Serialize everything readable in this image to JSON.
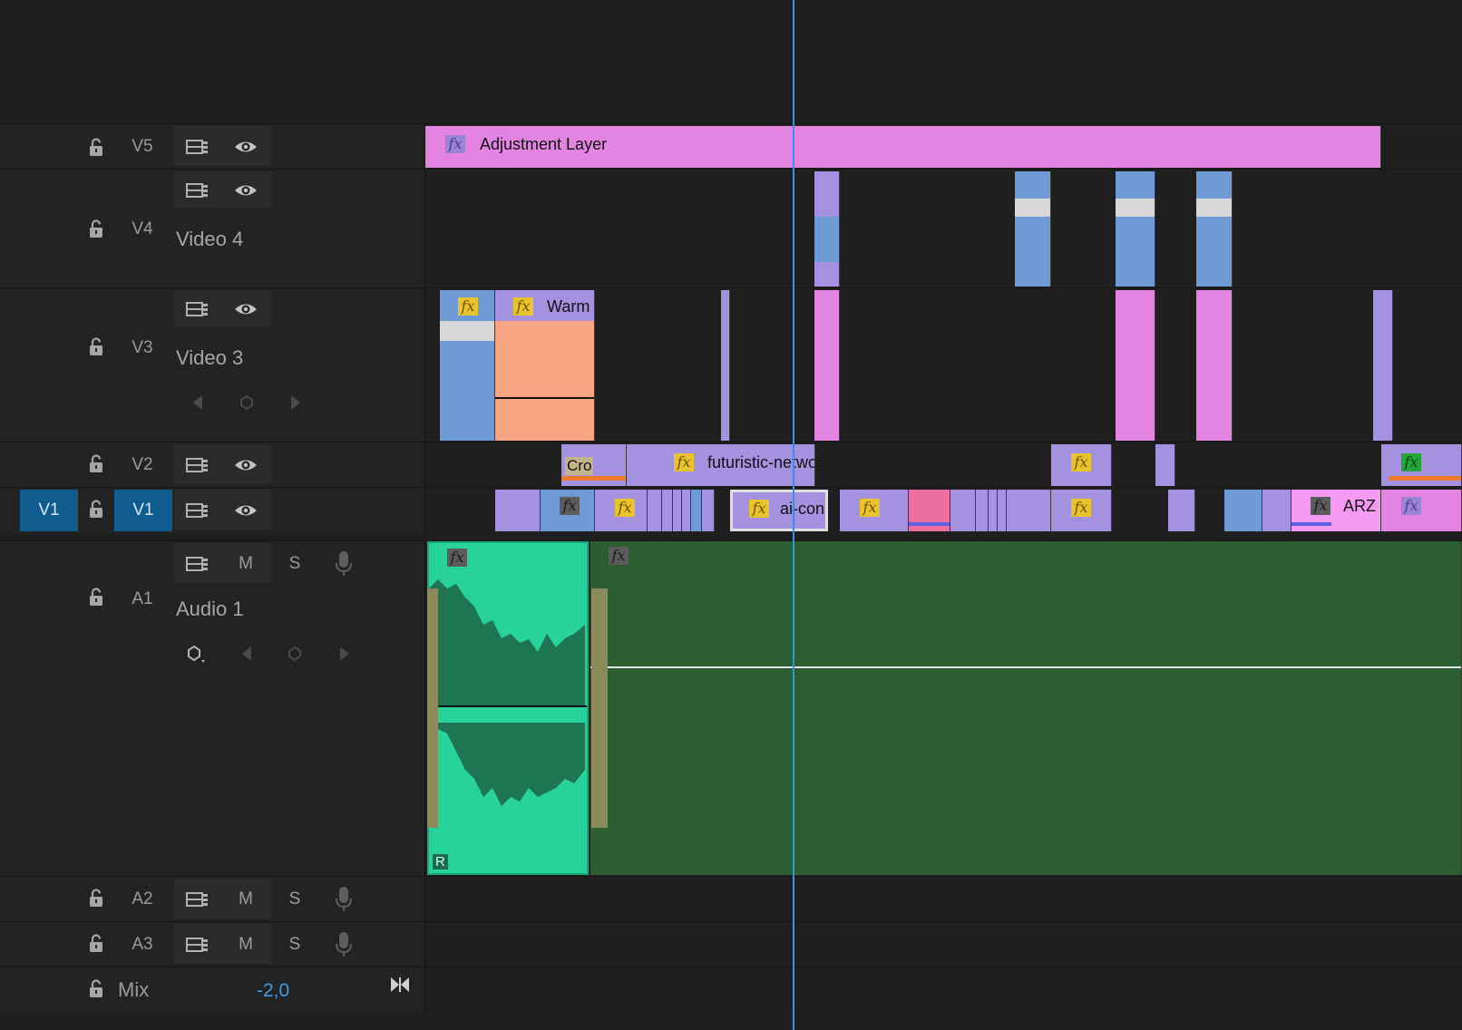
{
  "tracks": {
    "v5": {
      "name": "V5"
    },
    "v4": {
      "name": "V4",
      "label": "Video 4"
    },
    "v3": {
      "name": "V3",
      "label": "Video 3"
    },
    "v2": {
      "name": "V2"
    },
    "v1": {
      "name": "V1",
      "source_patch": "V1"
    },
    "a1": {
      "name": "A1",
      "label": "Audio 1",
      "mute": "M",
      "solo": "S"
    },
    "a2": {
      "name": "A2",
      "mute": "M",
      "solo": "S"
    },
    "a3": {
      "name": "A3",
      "mute": "M",
      "solo": "S"
    },
    "mix": {
      "name": "Mix",
      "value": "-2,0"
    }
  },
  "clips": {
    "adjustment": "Adjustment Layer",
    "warm": "Warm",
    "futuristic": "futuristic-network-tec",
    "cro": "Cro",
    "aicon": "ai-con",
    "arz": "ARZ",
    "audio_r": "R",
    "fx": "fx"
  },
  "colors": {
    "video_clip": "#a491e0",
    "adjustment_clip": "#e384e3",
    "blue_clip": "#6e9bd6",
    "audio_clip_selected": "#27d39a",
    "audio_clip": "#2b5e30",
    "source_patch": "#0f5c8f",
    "playhead": "#3a8fe8"
  },
  "icons": {
    "lock": "lock-icon",
    "toggle_output": "film-strip-icon",
    "eye": "eye-icon",
    "mic": "microphone-icon",
    "keyframe": "keyframe-icon",
    "prev": "previous-keyframe-icon",
    "next": "next-keyframe-icon"
  }
}
